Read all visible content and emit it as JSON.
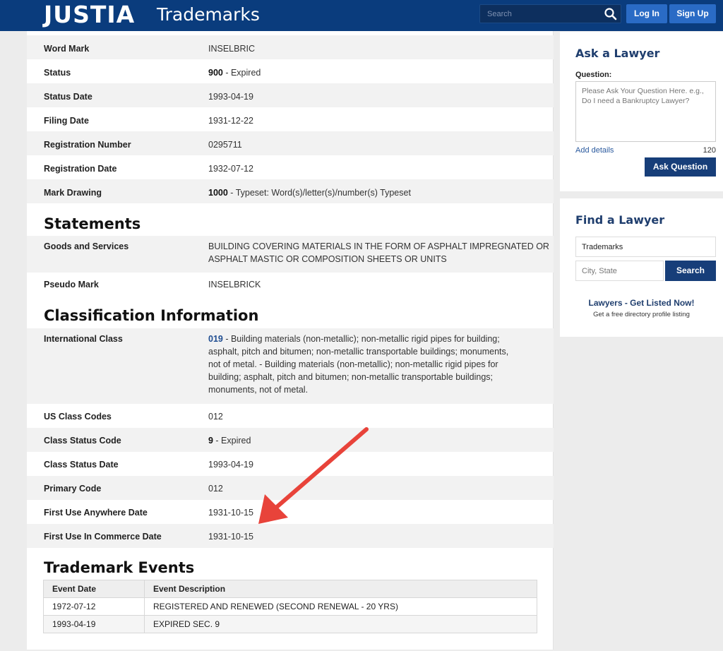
{
  "header": {
    "logo": "JUSTIA",
    "section": "Trademarks",
    "search_placeholder": "Search",
    "login_label": "Log In",
    "signup_label": "Sign Up"
  },
  "details": [
    {
      "label": "Word Mark",
      "value": "INSELBRIC"
    },
    {
      "label": "Status",
      "code": "900",
      "value": " - Expired"
    },
    {
      "label": "Status Date",
      "value": "1993-04-19"
    },
    {
      "label": "Filing Date",
      "value": "1931-12-22"
    },
    {
      "label": "Registration Number",
      "value": "0295711"
    },
    {
      "label": "Registration Date",
      "value": "1932-07-12"
    },
    {
      "label": "Mark Drawing",
      "code": "1000",
      "value": " - Typeset: Word(s)/letter(s)/number(s) Typeset"
    }
  ],
  "statements": {
    "title": "Statements",
    "goods_label": "Goods and Services",
    "goods_line1": "BUILDING COVERING MATERIALS IN THE FORM OF ASPHALT IMPREGNATED OR",
    "goods_line2": "ASPHALT MASTIC OR COMPOSITION SHEETS OR UNITS",
    "pseudo_label": "Pseudo Mark",
    "pseudo_value": "INSELBRICK"
  },
  "classification": {
    "title": "Classification Information",
    "intl_label": "International Class",
    "intl_code": "019",
    "intl_lines": [
      " - Building materials (non-metallic); non-metallic rigid pipes for building;",
      "asphalt, pitch and bitumen; non-metallic transportable buildings; monuments,",
      "not of metal. - Building materials (non-metallic); non-metallic rigid pipes for",
      "building; asphalt, pitch and bitumen; non-metallic transportable buildings;",
      "monuments, not of metal."
    ],
    "rows": [
      {
        "label": "US Class Codes",
        "value": "012"
      },
      {
        "label": "Class Status Code",
        "code": "9",
        "value": " - Expired"
      },
      {
        "label": "Class Status Date",
        "value": "1993-04-19"
      },
      {
        "label": "Primary Code",
        "value": "012"
      },
      {
        "label": "First Use Anywhere Date",
        "value": "1931-10-15"
      },
      {
        "label": "First Use In Commerce Date",
        "value": "1931-10-15"
      }
    ]
  },
  "events": {
    "title": "Trademark Events",
    "col_date": "Event Date",
    "col_desc": "Event Description",
    "rows": [
      {
        "date": "1972-07-12",
        "desc": "REGISTERED AND RENEWED (SECOND RENEWAL - 20 YRS)"
      },
      {
        "date": "1993-04-19",
        "desc": "EXPIRED SEC. 9"
      }
    ]
  },
  "ask_lawyer": {
    "title": "Ask a Lawyer",
    "question_label": "Question:",
    "placeholder": "Please Ask Your Question Here. e.g., Do I need a Bankruptcy Lawyer?",
    "add_details": "Add details",
    "char_count": "120",
    "button": "Ask Question"
  },
  "find_lawyer": {
    "title": "Find a Lawyer",
    "practice_value": "Trademarks",
    "location_placeholder": "City, State",
    "button": "Search",
    "listed_title": "Lawyers - Get Listed Now!",
    "listed_sub": "Get a free directory profile listing"
  },
  "annotation": {
    "arrow_color": "#e8433a"
  }
}
